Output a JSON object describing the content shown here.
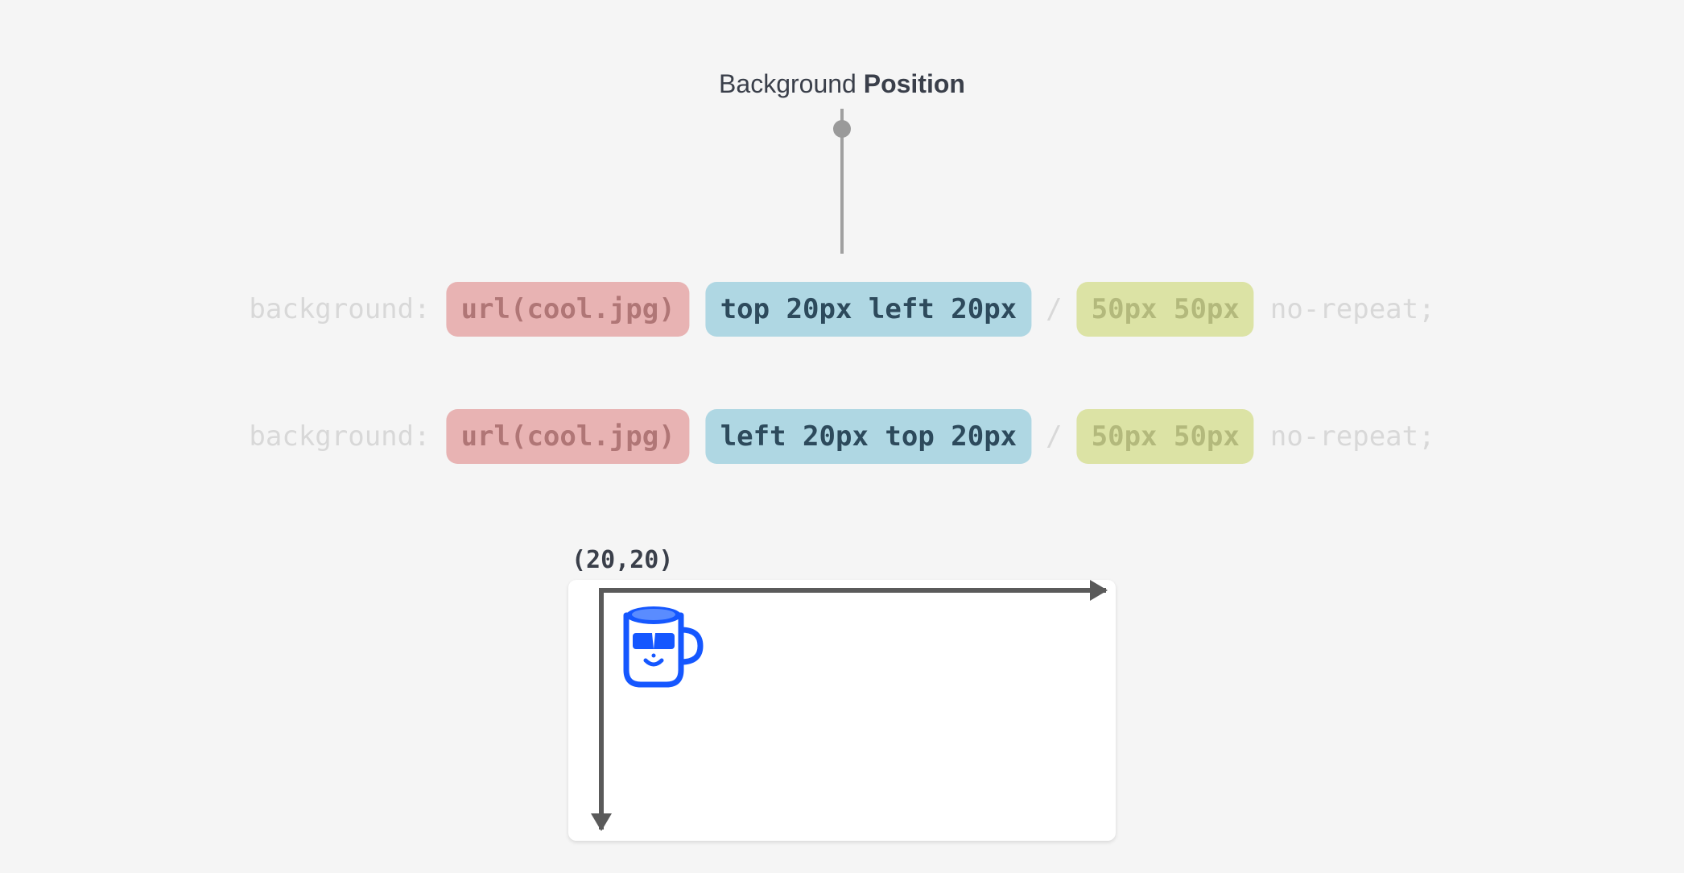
{
  "heading": {
    "prefix": "Background ",
    "emphasis": "Position"
  },
  "codeLines": [
    {
      "prop": "background:",
      "url": "url(cool.jpg)",
      "pos": "top 20px left 20px",
      "slash": "/",
      "size": "50px 50px",
      "repeat": "no-repeat;"
    },
    {
      "prop": "background:",
      "url": "url(cool.jpg)",
      "pos": "left 20px top 20px",
      "slash": "/",
      "size": "50px 50px",
      "repeat": "no-repeat;"
    }
  ],
  "preview": {
    "coordLabel": "(20,20)"
  },
  "colors": {
    "urlBg": "#e8b3b3",
    "posBg": "#afd7e3",
    "sizeBg": "#dce3a5",
    "mugBlue": "#1557ff"
  }
}
